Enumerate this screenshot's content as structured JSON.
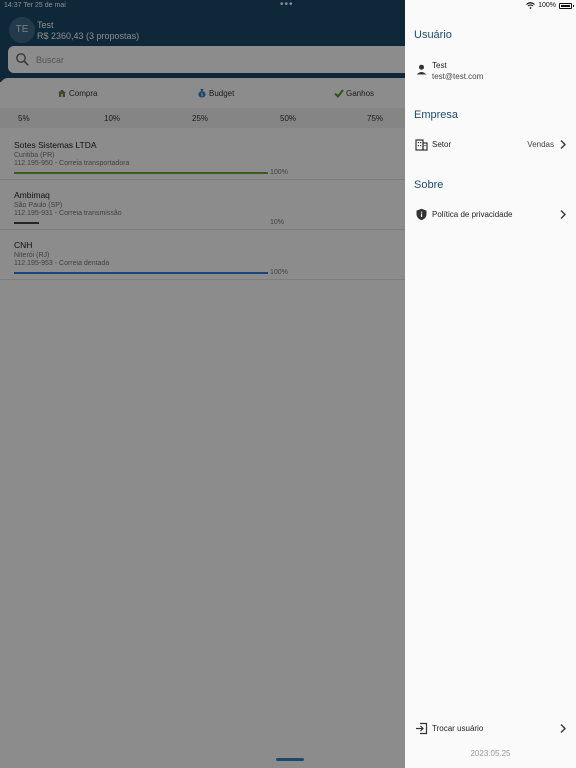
{
  "status_bar": {
    "time": "14:37",
    "date": "Ter 25 de mai",
    "battery": "100%"
  },
  "header": {
    "avatar_initials": "TE",
    "user_name": "Test",
    "total": "R$ 2360,43 (3 propostas)"
  },
  "search": {
    "placeholder": "Buscar"
  },
  "tabs": [
    {
      "label": "Compra",
      "icon": "house-icon"
    },
    {
      "label": "Budget",
      "icon": "money-bag-icon"
    },
    {
      "label": "Ganhos",
      "icon": "check-icon"
    }
  ],
  "percent_filters": [
    "5%",
    "10%",
    "25%",
    "50%",
    "75%"
  ],
  "proposals": [
    {
      "title": "Sotes Sistemas LTDA",
      "location": "Curitiba (PR)",
      "detail": "112.195-950 - Correia transportadora",
      "progress": 1.0,
      "progress_label": "100%",
      "bar_color": "#6aa83a"
    },
    {
      "title": "Ambimaq",
      "location": "São Paulo (SP)",
      "detail": "112.195-931 - Correia transmissão",
      "progress": 0.1,
      "progress_label": "10%",
      "bar_color": "#444444"
    },
    {
      "title": "CNH",
      "location": "Niterói (RJ)",
      "detail": "112.195-953 - Correia dentada",
      "progress": 1.0,
      "progress_label": "100%",
      "bar_color": "#2d7fd6"
    }
  ],
  "drawer": {
    "usuario": {
      "title": "Usuário",
      "name": "Test",
      "email": "test@test.com"
    },
    "empresa": {
      "title": "Empresa",
      "setor_label": "Setor",
      "setor_value": "Vendas"
    },
    "sobre": {
      "title": "Sobre",
      "privacy_label": "Política de privacidade"
    },
    "switch_user_label": "Trocar usuário",
    "version": "2023.05.25"
  },
  "colors": {
    "primary": "#1b4a6b",
    "bar_green": "#6aa83a",
    "bar_blue": "#2d7fd6"
  }
}
